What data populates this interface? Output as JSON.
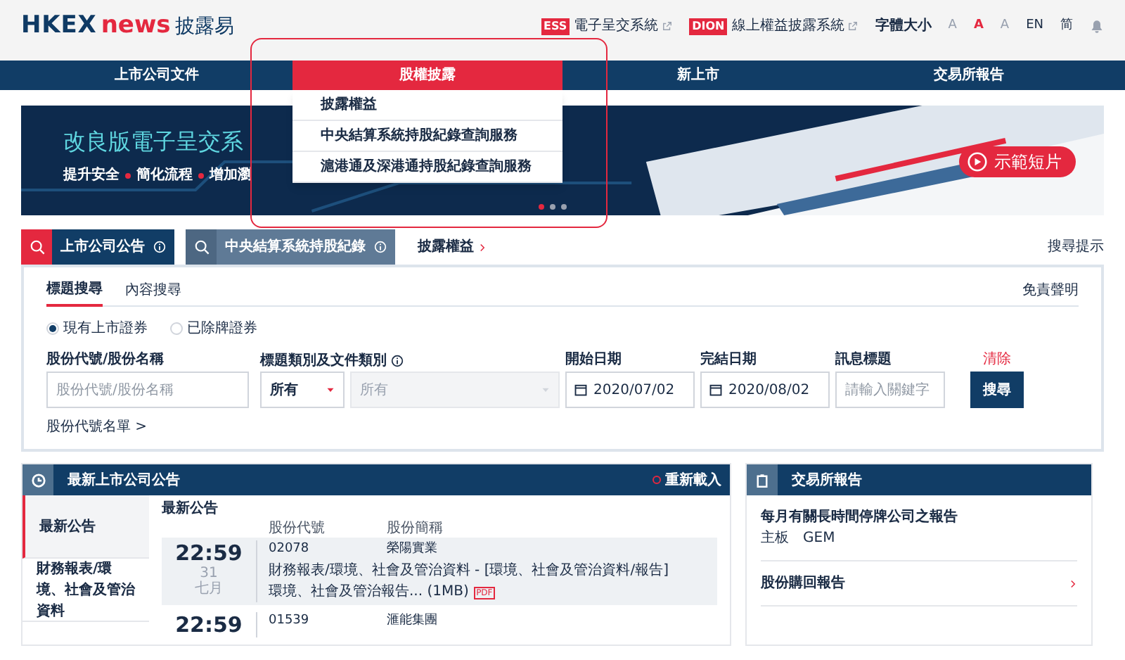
{
  "header": {
    "logo_mark": "HKEX",
    "logo_word": "news",
    "logo_cjk": "披露易",
    "links": [
      {
        "badge": "ESS",
        "label": "電子呈交系統"
      },
      {
        "badge": "DION",
        "label": "線上權益披露系統"
      }
    ],
    "font_size_label": "字體大小",
    "font_sizes": [
      {
        "label": "A",
        "selected": false
      },
      {
        "label": "A",
        "selected": true
      },
      {
        "label": "A",
        "selected": false
      }
    ],
    "languages": [
      "EN",
      "简"
    ]
  },
  "nav": [
    {
      "label": "上市公司文件",
      "selected": false
    },
    {
      "label": "股權披露",
      "selected": true
    },
    {
      "label": "新上市",
      "selected": false
    },
    {
      "label": "交易所報告",
      "selected": false
    }
  ],
  "dropdown": [
    "披露權益",
    "中央結算系統持股紀錄查詢服務",
    "滬港通及深港通持股紀錄查詢服務"
  ],
  "banner": {
    "title": "改良版電子呈交系",
    "subtitle": [
      "提升安全",
      "簡化流程",
      "增加瀏"
    ],
    "button": "示範短片",
    "dots": [
      {
        "selected": true
      },
      {
        "selected": false
      },
      {
        "selected": false
      }
    ]
  },
  "search_tabs": [
    {
      "label": "上市公司公告",
      "selected": true
    },
    {
      "label": "中央結算系統持股紀錄",
      "selected": false
    }
  ],
  "disclosure_link": "披露權益",
  "search_tips": "搜尋提示",
  "search": {
    "tabs": [
      {
        "label": "標題搜尋",
        "selected": true
      },
      {
        "label": "內容搜尋",
        "selected": false
      }
    ],
    "disclaimer": "免責聲明",
    "radios": [
      {
        "label": "現有上市證券",
        "selected": true
      },
      {
        "label": "已除牌證券",
        "selected": false
      }
    ],
    "stock_label": "股份代號/股份名稱",
    "stock_placeholder": "股份代號/股份名稱",
    "category_label": "標題類別及文件類別",
    "category_value": "所有",
    "doc_type_value": "所有",
    "start_label": "開始日期",
    "start_value": "2020/07/02",
    "end_label": "完結日期",
    "end_value": "2020/08/02",
    "title_label": "訊息標題",
    "title_placeholder": "請輸入關鍵字",
    "clear": "清除",
    "submit": "搜尋",
    "stock_list": "股份代號名單 >"
  },
  "latest": {
    "title": "最新上市公司公告",
    "reload": "重新載入",
    "sidebar": [
      {
        "label": "最新公告",
        "selected": true
      },
      {
        "label": "財務報表/環境、社會及管治資料",
        "selected": false
      }
    ],
    "heading": "最新公告",
    "columns": [
      "股份代號",
      "股份簡稱"
    ],
    "rows": [
      {
        "time": "22:59",
        "day": "31",
        "month": "七月",
        "code": "02078",
        "name": "榮陽實業",
        "text": "財務報表/環境、社會及管治資料 - [環境、社會及管治資料/報告]",
        "doc": "環境、社會及管治報告... (1MB)",
        "doc_type": "PDF"
      },
      {
        "time": "22:59",
        "code": "01539",
        "name": "滙能集團"
      }
    ]
  },
  "reports": {
    "title": "交易所報告",
    "items": [
      {
        "title": "每月有關長時間停牌公司之報告",
        "subs": [
          "主板",
          "GEM"
        ]
      },
      {
        "title": "股份購回報告"
      }
    ]
  }
}
